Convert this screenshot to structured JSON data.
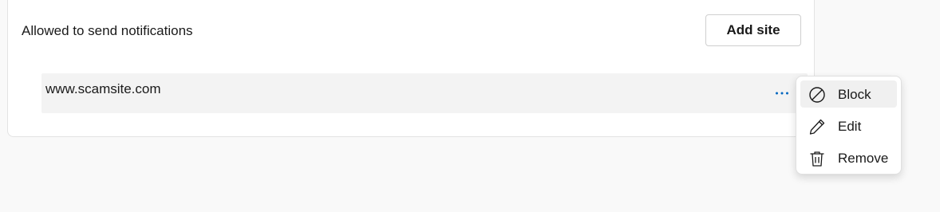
{
  "section": {
    "title": "Allowed to send notifications",
    "add_site_label": "Add site"
  },
  "sites": [
    {
      "name": "www.scamsite.com",
      "more_icon": "more-horizontal-icon"
    }
  ],
  "context_menu": {
    "items": [
      {
        "label": "Block",
        "icon": "block-icon",
        "highlighted": true
      },
      {
        "label": "Edit",
        "icon": "pencil-icon",
        "highlighted": false
      },
      {
        "label": "Remove",
        "icon": "trash-icon",
        "highlighted": false
      }
    ]
  },
  "colors": {
    "accent": "#0067c0",
    "background": "#f9f9f9",
    "card": "#ffffff",
    "row": "#f3f3f3"
  }
}
